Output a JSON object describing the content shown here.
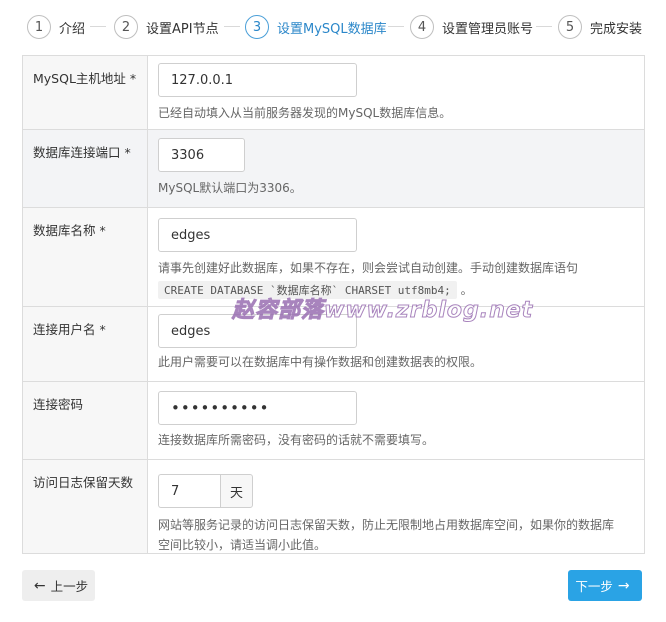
{
  "steps": [
    {
      "num": "1",
      "label": "介绍"
    },
    {
      "num": "2",
      "label": "设置API节点"
    },
    {
      "num": "3",
      "label": "设置MySQL数据库"
    },
    {
      "num": "4",
      "label": "设置管理员账号"
    },
    {
      "num": "5",
      "label": "完成安装"
    }
  ],
  "active_step": 3,
  "fields": {
    "host": {
      "label": "MySQL主机地址 *",
      "value": "127.0.0.1",
      "help": "已经自动填入从当前服务器发现的MySQL数据库信息。"
    },
    "port": {
      "label": "数据库连接端口 *",
      "value": "3306",
      "help": "MySQL默认端口为3306。"
    },
    "dbname": {
      "label": "数据库名称 *",
      "value": "edges",
      "help": "请事先创建好此数据库，如果不存在，则会尝试自动创建。手动创建数据库语句",
      "code": "CREATE DATABASE `数据库名称` CHARSET utf8mb4;",
      "code_suffix": "。"
    },
    "user": {
      "label": "连接用户名 *",
      "value": "edges",
      "help": "此用户需要可以在数据库中有操作数据和创建数据表的权限。"
    },
    "password": {
      "label": "连接密码",
      "value": "••••••••••",
      "help": "连接数据库所需密码，没有密码的话就不需要填写。"
    },
    "log_days": {
      "label": "访问日志保留天数",
      "value": "7",
      "unit": "天",
      "help_line1": "网站等服务记录的访问日志保留天数，防止无限制地占用数据库空间，如果你的数据库",
      "help_line2": "空间比较小，请适当调小此值。"
    }
  },
  "buttons": {
    "prev": "上一步",
    "next": "下一步"
  },
  "watermark": "赵容部落www.zrblog.net",
  "colors": {
    "accent": "#2aa3e5",
    "active_step": "#2b87c9"
  }
}
